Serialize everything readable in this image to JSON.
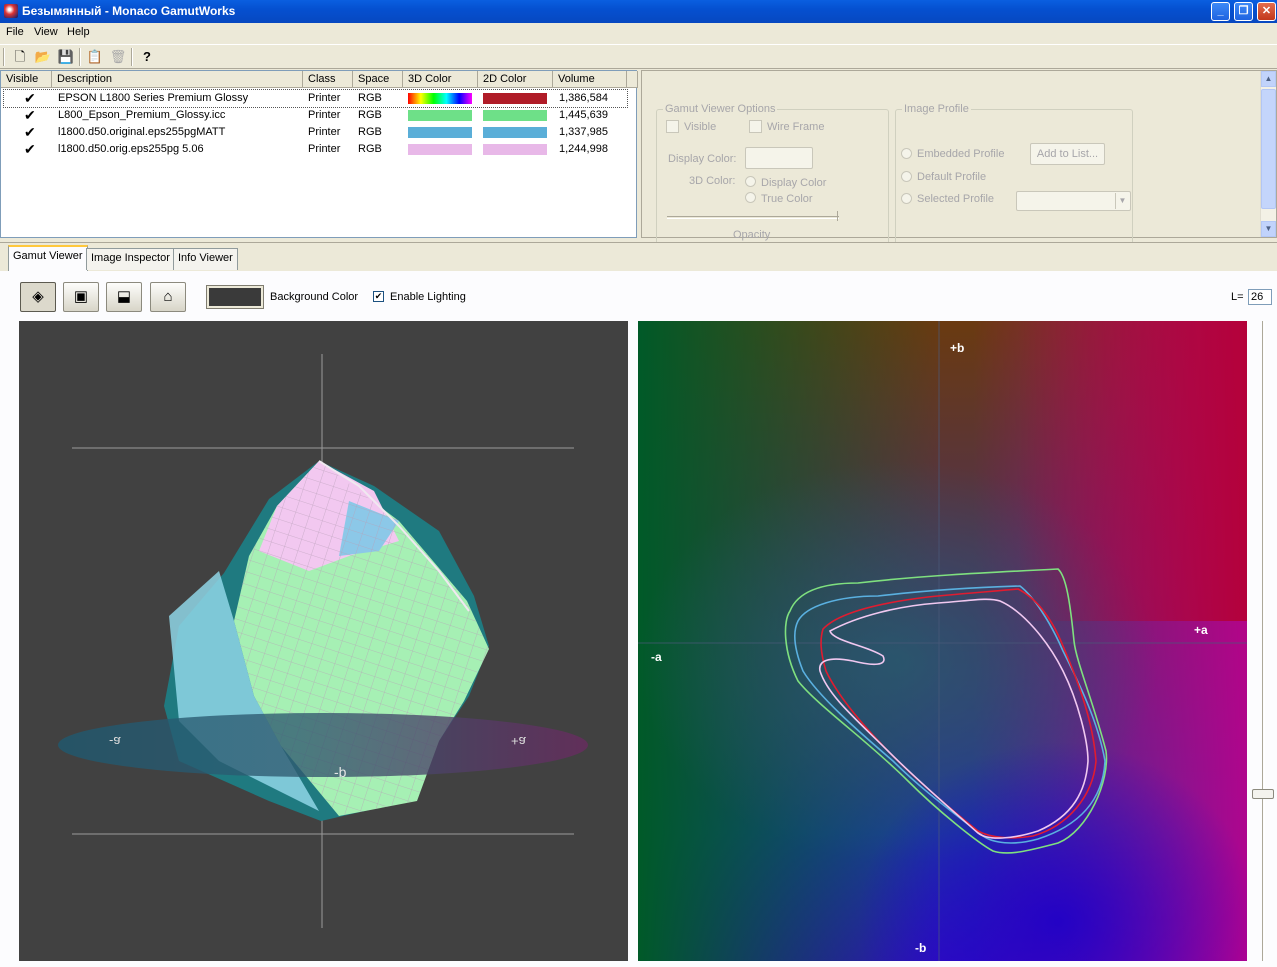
{
  "window": {
    "title": "Безымянный - Monaco GamutWorks"
  },
  "menu": [
    "File",
    "View",
    "Help"
  ],
  "list": {
    "columns": [
      "Visible",
      "Description",
      "Class",
      "Space",
      "3D Color",
      "2D Color",
      "Volume"
    ],
    "rows": [
      {
        "visible": true,
        "description": "EPSON L1800 Series Premium Glossy",
        "class": "Printer",
        "space": "RGB",
        "color3d": "spectrum",
        "color2d": "#b01c28",
        "volume": "1,386,584"
      },
      {
        "visible": true,
        "description": "L800_Epson_Premium_Glossy.icc",
        "class": "Printer",
        "space": "RGB",
        "color3d": "#6ee088",
        "color2d": "#6ee088",
        "volume": "1,445,639"
      },
      {
        "visible": true,
        "description": "l1800.d50.original.eps255pgMATT",
        "class": "Printer",
        "space": "RGB",
        "color3d": "#5aaed8",
        "color2d": "#5aaed8",
        "volume": "1,337,985"
      },
      {
        "visible": true,
        "description": "l1800.d50.orig.eps255pg 5.06",
        "class": "Printer",
        "space": "RGB",
        "color3d": "#e8b8e8",
        "color2d": "#e8b8e8",
        "volume": "1,244,998"
      }
    ]
  },
  "options": {
    "gamut_group": "Gamut Viewer Options",
    "visible": "Visible",
    "wireframe": "Wire Frame",
    "display_color": "Display Color:",
    "color3d": "3D Color:",
    "display_color_radio": "Display Color",
    "true_color_radio": "True Color",
    "opacity": "Opacity",
    "image_group": "Image Profile",
    "embedded": "Embedded Profile",
    "add_to_list": "Add to List...",
    "default_profile": "Default Profile",
    "selected_profile": "Selected Profile"
  },
  "tabs": [
    "Gamut Viewer",
    "Image Inspector",
    "Info Viewer"
  ],
  "viewer": {
    "background_label": "Background Color",
    "background_color": "#3a3a3a",
    "enable_lighting": "Enable Lighting",
    "lighting_checked": true,
    "l_label": "L=",
    "l_value": "26",
    "axis3d": {
      "minus_a": "-a",
      "plus_a": "+a",
      "minus_b": "-b"
    },
    "axis2d": {
      "plus_b": "+b",
      "minus_a": "-a",
      "plus_a": "+a",
      "minus_b": "-b"
    }
  },
  "colors": {
    "green": "#6ee088",
    "blue": "#5aaed8",
    "pink": "#e8b8e8",
    "red": "#c01c28"
  }
}
